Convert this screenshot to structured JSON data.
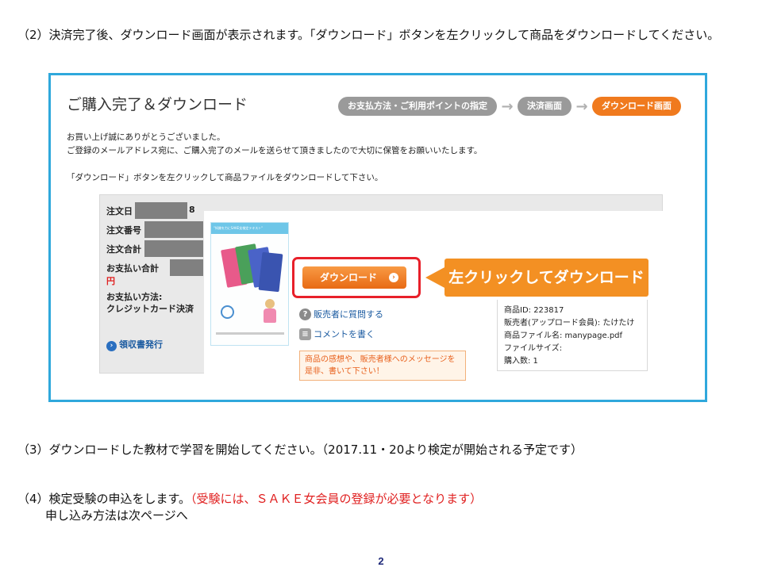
{
  "instructions": {
    "step2": "（2）決済完了後、ダウンロード画面が表示されます。「ダウンロード」ボタンを左クリックして商品をダウンロードしてください。",
    "step3": "（3）ダウンロードした教材で学習を開始してください。（2017.11・20より検定が開始される予定です）",
    "step4_prefix": "（4）検定受験の申込をします。",
    "step4_red": "（受験には、ＳＡＫＥ女会員の登録が必要となります）",
    "step4_line2": "申し込み方法は次ページへ"
  },
  "page_number": "2",
  "screenshot": {
    "title": "ご購入完了＆ダウンロード",
    "progress": [
      "お支払方法・ご利用ポイントの指定",
      "決済画面",
      "ダウンロード画面"
    ],
    "progress_active_index": 2,
    "intro_line1": "お買い上げ誠にありがとうございました。",
    "intro_line2": "ご登録のメールアドレス宛に、ご購入完了のメールを送らせて頂きましたので大切に保管をお願いいたします。",
    "intro_line3": "「ダウンロード」ボタンを左クリックして商品ファイルをダウンロードして下さい。",
    "order": {
      "date_label": "注文日",
      "date_tail": "8",
      "number_label": "注文番号",
      "total_label": "注文合計",
      "paid_label": "お支払い合計",
      "paid_unit": "円",
      "method_label": "お支払い方法:",
      "method_value": "クレジットカード決済",
      "receipt_label": "領収書発行"
    },
    "product_thumb_caption": "\"知識を力にSAKE女検定テキスト\"",
    "download_button": "ダウンロード",
    "callout": "左クリックしてダウンロード",
    "ask_link": "販売者に質問する",
    "comment_link": "コメントを書く",
    "message_note": "商品の感想や、販売者様へのメッセージを是非、書いて下さい！",
    "details": {
      "product_id": "商品ID: 223817",
      "seller": "販売者(アップロード会員): たけたけ",
      "file_name": "商品ファイル名: manypage.pdf",
      "file_size": "ファイルサイズ:",
      "quantity": "購入数: 1"
    }
  },
  "colors": {
    "frame": "#2fa8dc",
    "accent_orange": "#f39023",
    "highlight_red": "#e8202a",
    "note_red": "#e02020"
  }
}
